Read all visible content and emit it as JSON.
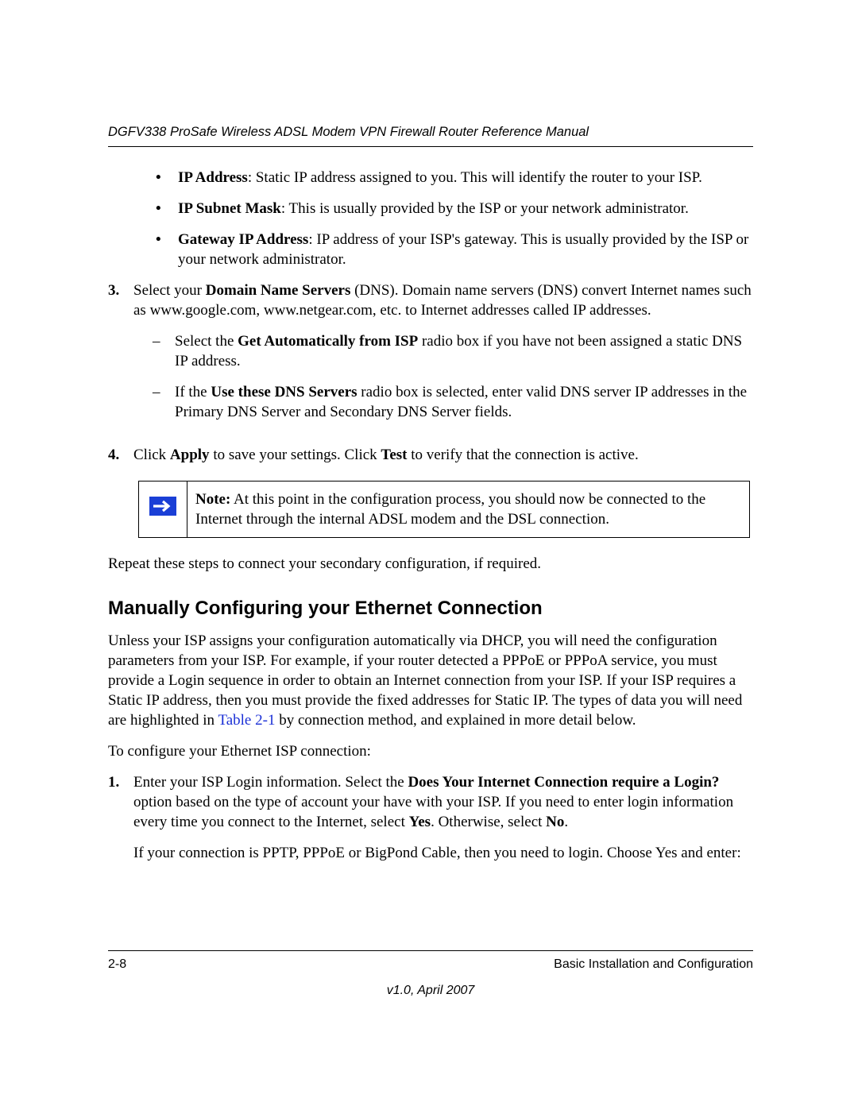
{
  "header": {
    "manual_title": "DGFV338 ProSafe Wireless ADSL Modem VPN Firewall Router Reference Manual"
  },
  "bullets_top": [
    {
      "label": "IP Address",
      "text": ": Static IP address assigned to you. This will identify the router to your ISP."
    },
    {
      "label": "IP Subnet Mask",
      "text": ": This is usually provided by the ISP or your network administrator."
    },
    {
      "label": "Gateway IP Address",
      "text": ": IP address of your ISP's gateway. This is usually provided by the ISP or your network administrator."
    }
  ],
  "step3": {
    "num": "3.",
    "lead_a": "Select your ",
    "bold_a": "Domain Name Servers",
    "tail_a": " (DNS). Domain name servers (DNS) convert Internet names such as www.google.com, www.netgear.com, etc. to Internet addresses called IP addresses."
  },
  "step3_dashes": [
    {
      "lead": "Select the ",
      "bold": "Get Automatically from ISP",
      "tail": " radio box if you have not been assigned a static DNS IP address."
    },
    {
      "lead": "If the ",
      "bold": "Use these DNS Servers",
      "tail": " radio box is selected, enter valid DNS server IP addresses in the Primary DNS Server and Secondary DNS Server fields."
    }
  ],
  "step4": {
    "num": "4.",
    "p1": "Click ",
    "b1": "Apply",
    "p2": " to save your settings. Click ",
    "b2": "Test",
    "p3": " to verify that the connection is active."
  },
  "note": {
    "label": "Note:",
    "text": " At this point in the configuration process, you should now be connected to the Internet through the internal ADSL modem and the DSL connection."
  },
  "repeat_text": "Repeat these steps to connect your secondary configuration, if required.",
  "heading": "Manually Configuring your Ethernet Connection",
  "para1": {
    "pre": "Unless your ISP assigns your configuration automatically via DHCP, you will need the configuration parameters from your ISP. For example, if your router detected a PPPoE or PPPoA service, you must provide a Login sequence in order to obtain an Internet connection from your ISP. If your ISP requires a Static IP address, then you must provide the fixed addresses for Static IP. The types of data you will need are highlighted in ",
    "link": "Table 2-1",
    "post": " by connection method, and explained in more detail below."
  },
  "para2": "To configure your Ethernet ISP connection:",
  "step1eth": {
    "num": "1.",
    "p1": "Enter your ISP Login information. Select the ",
    "b1": "Does Your Internet Connection require a Login?",
    "p2": " option based on the type of account your have with your ISP. If you need to enter login information every time you connect to the Internet, select ",
    "b2": "Yes",
    "p3": ". Otherwise, select ",
    "b3": "No",
    "p4": ".",
    "extra": "If your connection is PPTP, PPPoE or BigPond Cable, then you need to login. Choose Yes and enter:"
  },
  "footer": {
    "page_num": "2-8",
    "chapter": "Basic Installation and Configuration",
    "version": "v1.0, April 2007"
  }
}
